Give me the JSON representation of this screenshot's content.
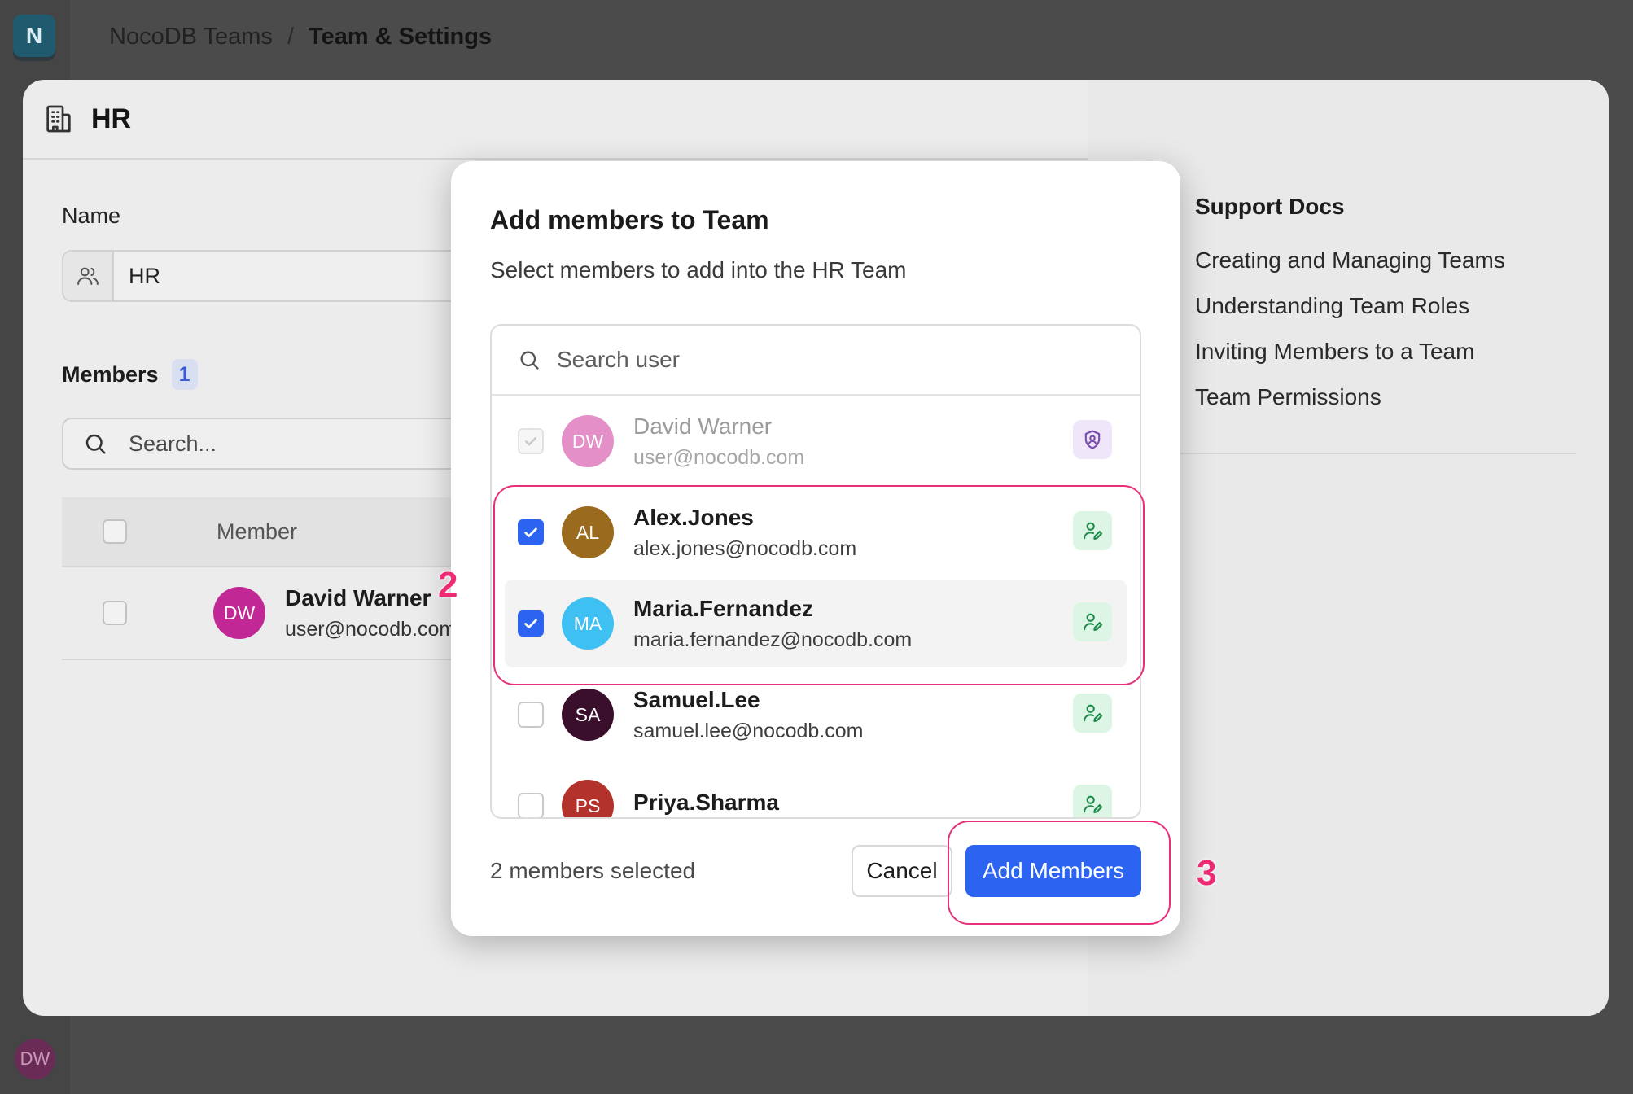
{
  "app": {
    "logo_letter": "N",
    "breadcrumb": {
      "root": "NocoDB Teams",
      "separator": "/",
      "current": "Team & Settings"
    },
    "user_avatar_initials": "DW"
  },
  "team_modal": {
    "title": "HR",
    "name_label": "Name",
    "name_value": "HR",
    "members_label": "Members",
    "members_count": "1",
    "search_placeholder": "Search...",
    "table_header_member": "Member",
    "rows": [
      {
        "initials": "DW",
        "name": "David Warner",
        "email": "user@nocodb.com"
      }
    ],
    "docs": {
      "title": "Support Docs",
      "links": [
        "Creating and Managing Teams",
        "Understanding Team Roles",
        "Inviting Members to a Team",
        "Team Permissions"
      ]
    }
  },
  "dialog": {
    "title": "Add members to Team",
    "subtitle": "Select members to add into the HR Team",
    "search_placeholder": "Search user",
    "users": [
      {
        "initials": "DW",
        "name": "David Warner",
        "email": "user@nocodb.com",
        "state": "disabled",
        "role_icon": "shield-user-icon",
        "avatar_color": "#e58fc8"
      },
      {
        "initials": "AL",
        "name": "Alex.Jones",
        "email": "alex.jones@nocodb.com",
        "state": "checked",
        "role_icon": "user-edit-icon",
        "avatar_color": "#9a6a1e"
      },
      {
        "initials": "MA",
        "name": "Maria.Fernandez",
        "email": "maria.fernandez@nocodb.com",
        "state": "checked",
        "role_icon": "user-edit-icon",
        "avatar_color": "#3ec0f2"
      },
      {
        "initials": "SA",
        "name": "Samuel.Lee",
        "email": "samuel.lee@nocodb.com",
        "state": "unchecked",
        "role_icon": "user-edit-icon",
        "avatar_color": "#3a0f2c"
      },
      {
        "initials": "PS",
        "name": "Priya.Sharma",
        "email": "",
        "state": "unchecked",
        "role_icon": "user-edit-icon",
        "avatar_color": "#b3322b"
      }
    ],
    "selected_count_text": "2 members selected",
    "cancel_label": "Cancel",
    "add_label": "Add Members"
  },
  "annotations": {
    "step_two": "2",
    "step_three": "3"
  },
  "colors": {
    "primary": "#2c63f0",
    "annotation": "#e8307a"
  }
}
